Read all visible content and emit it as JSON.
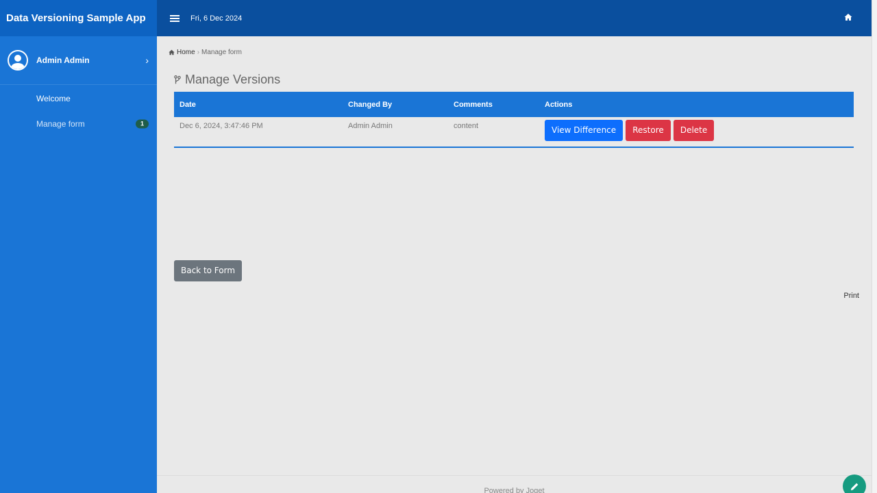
{
  "app": {
    "title": "Data Versioning Sample App"
  },
  "topbar": {
    "date": "Fri, 6 Dec 2024"
  },
  "user": {
    "name": "Admin Admin"
  },
  "sidebar": {
    "items": [
      {
        "label": "Welcome"
      },
      {
        "label": "Manage form",
        "badge": "1"
      }
    ]
  },
  "breadcrumb": {
    "home": "Home",
    "current": "Manage form"
  },
  "page": {
    "title": "Manage Versions"
  },
  "table": {
    "headers": [
      "Date",
      "Changed By",
      "Comments",
      "Actions"
    ],
    "rows": [
      {
        "date": "Dec 6, 2024, 3:47:46 PM",
        "changed_by": "Admin Admin",
        "comments": "content"
      }
    ],
    "actions": {
      "view": "View Difference",
      "restore": "Restore",
      "delete": "Delete"
    }
  },
  "buttons": {
    "back": "Back to Form",
    "print": "Print"
  },
  "footer": {
    "text": "Powered by Joget"
  },
  "colors": {
    "sidebar": "#1a75d6",
    "topbar": "#0a4f9e",
    "primary": "#0d6efd",
    "danger": "#dc3545",
    "secondary": "#6c757d",
    "fab": "#169b80"
  }
}
